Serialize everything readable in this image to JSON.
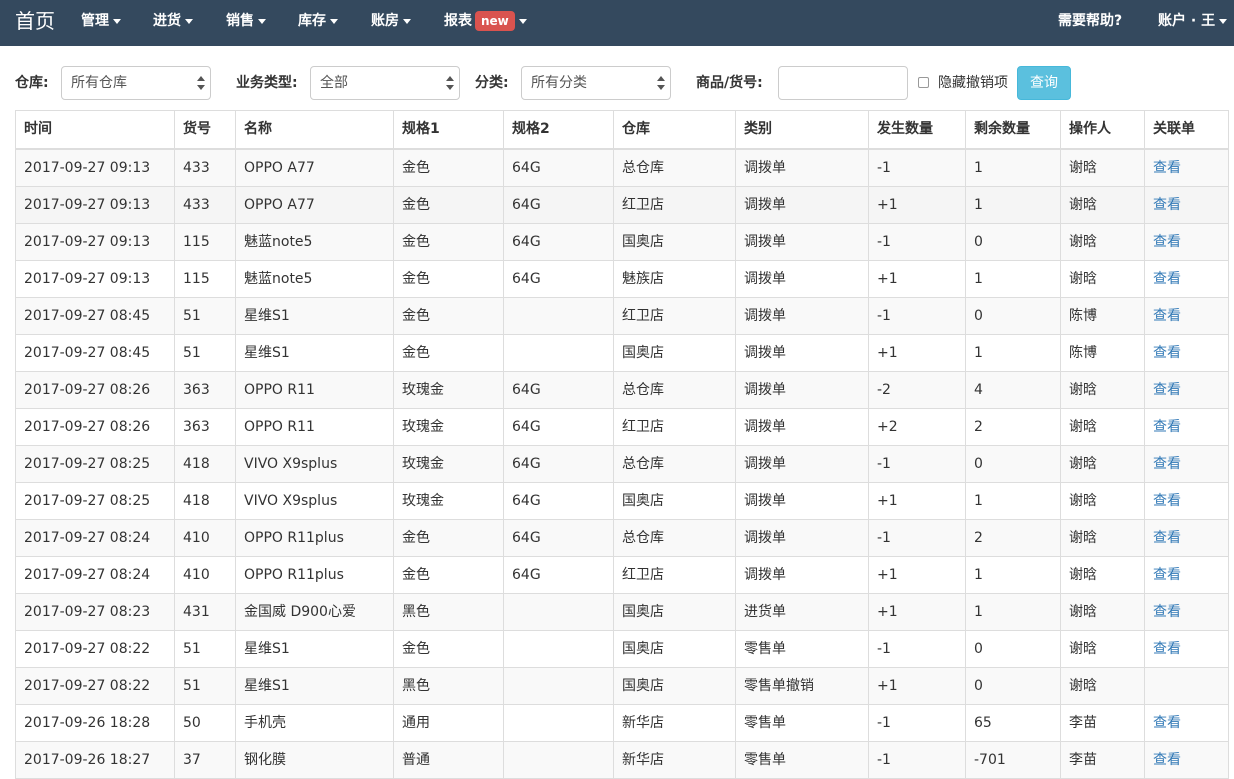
{
  "nav": {
    "brand": "首页",
    "items": [
      {
        "label": "管理",
        "badge": null
      },
      {
        "label": "进货",
        "badge": null
      },
      {
        "label": "销售",
        "badge": null
      },
      {
        "label": "库存",
        "badge": null
      },
      {
        "label": "账房",
        "badge": null
      },
      {
        "label": "报表",
        "badge": "new"
      }
    ],
    "help": "需要帮助?",
    "account": "账户 · 王"
  },
  "filters": {
    "warehouse_label": "仓库:",
    "warehouse_value": "所有仓库",
    "biztype_label": "业务类型:",
    "biztype_value": "全部",
    "category_label": "分类:",
    "category_value": "所有分类",
    "product_label": "商品/货号:",
    "product_value": "",
    "hide_label": "隐藏撤销项",
    "query_label": "查询"
  },
  "table": {
    "columns": [
      "时间",
      "货号",
      "名称",
      "规格1",
      "规格2",
      "仓库",
      "类别",
      "发生数量",
      "剩余数量",
      "操作人",
      "关联单"
    ],
    "rows": [
      [
        "2017-09-27 09:13",
        "433",
        "OPPO A77",
        "金色",
        "64G",
        "总仓库",
        "调拨单",
        "-1",
        "1",
        "谢晗",
        "查看"
      ],
      [
        "2017-09-27 09:13",
        "433",
        "OPPO A77",
        "金色",
        "64G",
        "红卫店",
        "调拨单",
        "+1",
        "1",
        "谢晗",
        "查看"
      ],
      [
        "2017-09-27 09:13",
        "115",
        "魅蓝note5",
        "金色",
        "64G",
        "国奥店",
        "调拨单",
        "-1",
        "0",
        "谢晗",
        "查看"
      ],
      [
        "2017-09-27 09:13",
        "115",
        "魅蓝note5",
        "金色",
        "64G",
        "魅族店",
        "调拨单",
        "+1",
        "1",
        "谢晗",
        "查看"
      ],
      [
        "2017-09-27 08:45",
        "51",
        "星维S1",
        "金色",
        "",
        "红卫店",
        "调拨单",
        "-1",
        "0",
        "陈博",
        "查看"
      ],
      [
        "2017-09-27 08:45",
        "51",
        "星维S1",
        "金色",
        "",
        "国奥店",
        "调拨单",
        "+1",
        "1",
        "陈博",
        "查看"
      ],
      [
        "2017-09-27 08:26",
        "363",
        "OPPO R11",
        "玫瑰金",
        "64G",
        "总仓库",
        "调拨单",
        "-2",
        "4",
        "谢晗",
        "查看"
      ],
      [
        "2017-09-27 08:26",
        "363",
        "OPPO R11",
        "玫瑰金",
        "64G",
        "红卫店",
        "调拨单",
        "+2",
        "2",
        "谢晗",
        "查看"
      ],
      [
        "2017-09-27 08:25",
        "418",
        "VIVO X9splus",
        "玫瑰金",
        "64G",
        "总仓库",
        "调拨单",
        "-1",
        "0",
        "谢晗",
        "查看"
      ],
      [
        "2017-09-27 08:25",
        "418",
        "VIVO X9splus",
        "玫瑰金",
        "64G",
        "国奥店",
        "调拨单",
        "+1",
        "1",
        "谢晗",
        "查看"
      ],
      [
        "2017-09-27 08:24",
        "410",
        "OPPO R11plus",
        "金色",
        "64G",
        "总仓库",
        "调拨单",
        "-1",
        "2",
        "谢晗",
        "查看"
      ],
      [
        "2017-09-27 08:24",
        "410",
        "OPPO R11plus",
        "金色",
        "64G",
        "红卫店",
        "调拨单",
        "+1",
        "1",
        "谢晗",
        "查看"
      ],
      [
        "2017-09-27 08:23",
        "431",
        "金国威 D900心爱",
        "黑色",
        "",
        "国奥店",
        "进货单",
        "+1",
        "1",
        "谢晗",
        "查看"
      ],
      [
        "2017-09-27 08:22",
        "51",
        "星维S1",
        "金色",
        "",
        "国奥店",
        "零售单",
        "-1",
        "0",
        "谢晗",
        "查看"
      ],
      [
        "2017-09-27 08:22",
        "51",
        "星维S1",
        "黑色",
        "",
        "国奥店",
        "零售单撤销",
        "+1",
        "0",
        "谢晗",
        ""
      ],
      [
        "2017-09-26 18:28",
        "50",
        "手机壳",
        "通用",
        "",
        "新华店",
        "零售单",
        "-1",
        "65",
        "李苗",
        "查看"
      ],
      [
        "2017-09-26 18:27",
        "37",
        "钢化膜",
        "普通",
        "",
        "新华店",
        "零售单",
        "-1",
        "-701",
        "李苗",
        "查看"
      ]
    ]
  }
}
